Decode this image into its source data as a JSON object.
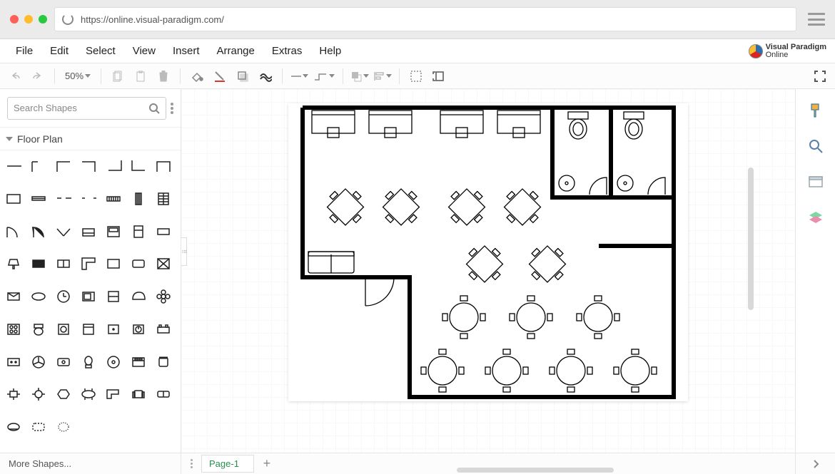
{
  "browser": {
    "url": "https://online.visual-paradigm.com/"
  },
  "brand": {
    "line1": "Visual Paradigm",
    "line2": "Online"
  },
  "menu": {
    "file": "File",
    "edit": "Edit",
    "select": "Select",
    "view": "View",
    "insert": "Insert",
    "arrange": "Arrange",
    "extras": "Extras",
    "help": "Help"
  },
  "toolbar": {
    "zoom": "50%"
  },
  "sidebar": {
    "search_placeholder": "Search Shapes",
    "panel_title": "Floor Plan",
    "more_shapes": "More Shapes..."
  },
  "tabs": {
    "page1": "Page-1"
  },
  "right_rail": {
    "format": "format-panel",
    "zoom": "zoom-tool",
    "outline": "outline",
    "layers": "layers"
  }
}
